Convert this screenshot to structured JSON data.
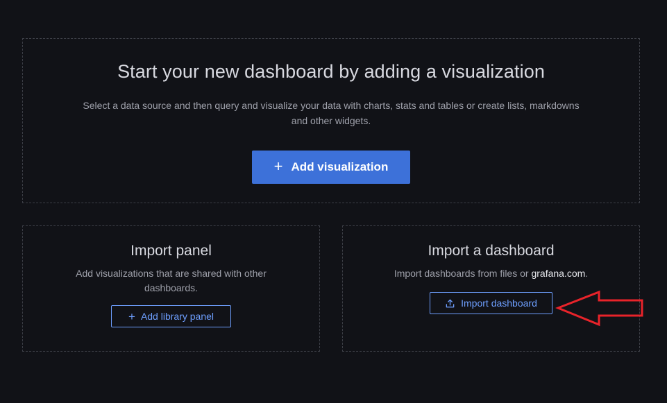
{
  "main_card": {
    "title": "Start your new dashboard by adding a visualization",
    "description": "Select a data source and then query and visualize your data with charts, stats and tables or create lists, markdowns and other widgets.",
    "button_icon": "+",
    "button_label": "Add visualization"
  },
  "import_panel": {
    "title": "Import panel",
    "description": "Add visualizations that are shared with other dashboards.",
    "button_icon": "+",
    "button_label": "Add library panel"
  },
  "import_dashboard": {
    "title": "Import a dashboard",
    "description_prefix": "Import dashboards from files or ",
    "description_link": "grafana.com",
    "description_suffix": ".",
    "button_icon": "upload-icon",
    "button_label": "Import dashboard"
  },
  "annotation": {
    "icon": "red-arrow-annotation-icon",
    "color": "#e8232a"
  },
  "colors": {
    "background": "#111217",
    "primary_button": "#3d71d9",
    "outline_button": "#6e9fff",
    "border": "#3d3f47"
  }
}
